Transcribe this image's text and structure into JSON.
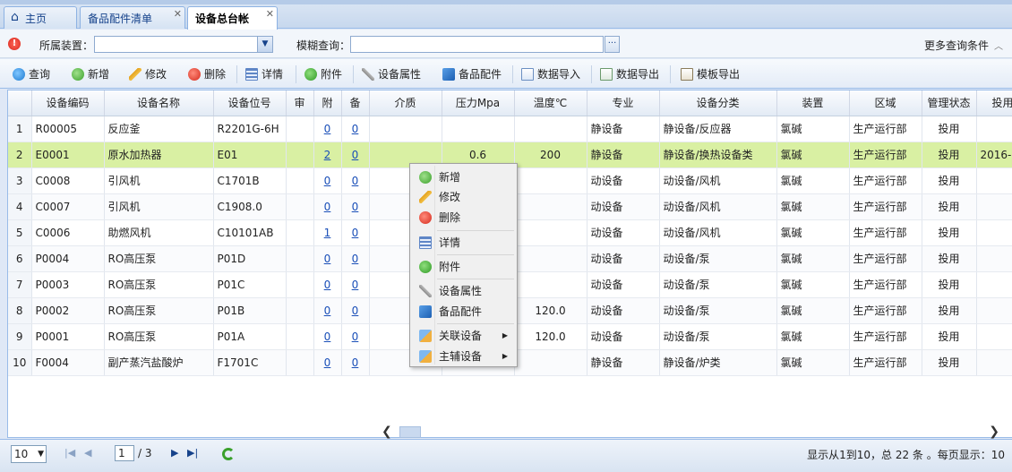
{
  "tabs": [
    {
      "label": "主页"
    },
    {
      "label": "备品配件清单"
    },
    {
      "label": "设备总台帐"
    }
  ],
  "query": {
    "device_label": "所属装置：",
    "fuzzy_label": "模糊查询：",
    "more_label": "更多查询条件",
    "fuzzy_btn": "···"
  },
  "toolbar": {
    "query": "查询",
    "add": "新增",
    "edit": "修改",
    "delete": "删除",
    "detail": "详情",
    "attach": "附件",
    "props": "设备属性",
    "parts": "备品配件",
    "import": "数据导入",
    "export": "数据导出",
    "template": "模板导出"
  },
  "columns": [
    "",
    "设备编码",
    "设备名称",
    "设备位号",
    "审",
    "附",
    "备",
    "介质",
    "压力Mpa",
    "温度℃",
    "专业",
    "设备分类",
    "装置",
    "区域",
    "管理状态",
    "投用"
  ],
  "rows": [
    {
      "n": "1",
      "code": "R00005",
      "name": "反应釜",
      "tag": "R2201G-6H",
      "shen": "",
      "fu": "0",
      "bei": "0",
      "medium": "",
      "pressure": "",
      "temp": "",
      "major": "静设备",
      "cat": "静设备/反应器",
      "unit": "氯碱",
      "area": "生产运行部",
      "status": "投用",
      "date": ""
    },
    {
      "n": "2",
      "code": "E0001",
      "name": "原水加热器",
      "tag": "E01",
      "shen": "",
      "fu": "2",
      "bei": "0",
      "medium": "",
      "pressure": "0.6",
      "temp": "200",
      "major": "静设备",
      "cat": "静设备/换热设备类",
      "unit": "氯碱",
      "area": "生产运行部",
      "status": "投用",
      "date": "2016-"
    },
    {
      "n": "3",
      "code": "C0008",
      "name": "引风机",
      "tag": "C1701B",
      "shen": "",
      "fu": "0",
      "bei": "0",
      "medium": "",
      "pressure": "",
      "temp": "",
      "major": "动设备",
      "cat": "动设备/风机",
      "unit": "氯碱",
      "area": "生产运行部",
      "status": "投用",
      "date": ""
    },
    {
      "n": "4",
      "code": "C0007",
      "name": "引风机",
      "tag": "C1908.0",
      "shen": "",
      "fu": "0",
      "bei": "0",
      "medium": "",
      "pressure": "",
      "temp": "",
      "major": "动设备",
      "cat": "动设备/风机",
      "unit": "氯碱",
      "area": "生产运行部",
      "status": "投用",
      "date": ""
    },
    {
      "n": "5",
      "code": "C0006",
      "name": "助燃风机",
      "tag": "C10101AB",
      "shen": "",
      "fu": "1",
      "bei": "0",
      "medium": "",
      "pressure": "",
      "temp": "",
      "major": "动设备",
      "cat": "动设备/风机",
      "unit": "氯碱",
      "area": "生产运行部",
      "status": "投用",
      "date": ""
    },
    {
      "n": "6",
      "code": "P0004",
      "name": "RO高压泵",
      "tag": "P01D",
      "shen": "",
      "fu": "0",
      "bei": "0",
      "medium": "",
      "pressure": "",
      "temp": "",
      "major": "动设备",
      "cat": "动设备/泵",
      "unit": "氯碱",
      "area": "生产运行部",
      "status": "投用",
      "date": ""
    },
    {
      "n": "7",
      "code": "P0003",
      "name": "RO高压泵",
      "tag": "P01C",
      "shen": "",
      "fu": "0",
      "bei": "0",
      "medium": "",
      "pressure": "",
      "temp": "",
      "major": "动设备",
      "cat": "动设备/泵",
      "unit": "氯碱",
      "area": "生产运行部",
      "status": "投用",
      "date": ""
    },
    {
      "n": "8",
      "code": "P0002",
      "name": "RO高压泵",
      "tag": "P01B",
      "shen": "",
      "fu": "0",
      "bei": "0",
      "medium": "",
      "pressure": "",
      "temp": "120.0",
      "major": "动设备",
      "cat": "动设备/泵",
      "unit": "氯碱",
      "area": "生产运行部",
      "status": "投用",
      "date": ""
    },
    {
      "n": "9",
      "code": "P0001",
      "name": "RO高压泵",
      "tag": "P01A",
      "shen": "",
      "fu": "0",
      "bei": "0",
      "medium": "",
      "pressure": "",
      "temp": "120.0",
      "major": "动设备",
      "cat": "动设备/泵",
      "unit": "氯碱",
      "area": "生产运行部",
      "status": "投用",
      "date": ""
    },
    {
      "n": "10",
      "code": "F0004",
      "name": "副产蒸汽盐酸炉",
      "tag": "F1701C",
      "shen": "",
      "fu": "0",
      "bei": "0",
      "medium": "",
      "pressure": "",
      "temp": "",
      "major": "静设备",
      "cat": "静设备/炉类",
      "unit": "氯碱",
      "area": "生产运行部",
      "status": "投用",
      "date": ""
    }
  ],
  "context_menu": {
    "add": "新增",
    "edit": "修改",
    "delete": "删除",
    "detail": "详情",
    "attach": "附件",
    "props": "设备属性",
    "parts": "备品配件",
    "related": "关联设备",
    "main_aux": "主辅设备"
  },
  "pager": {
    "page_size": "10",
    "current_page": "1",
    "total_pages": "/ 3",
    "info": "显示从1到10，总 22 条 。每页显示：10"
  }
}
